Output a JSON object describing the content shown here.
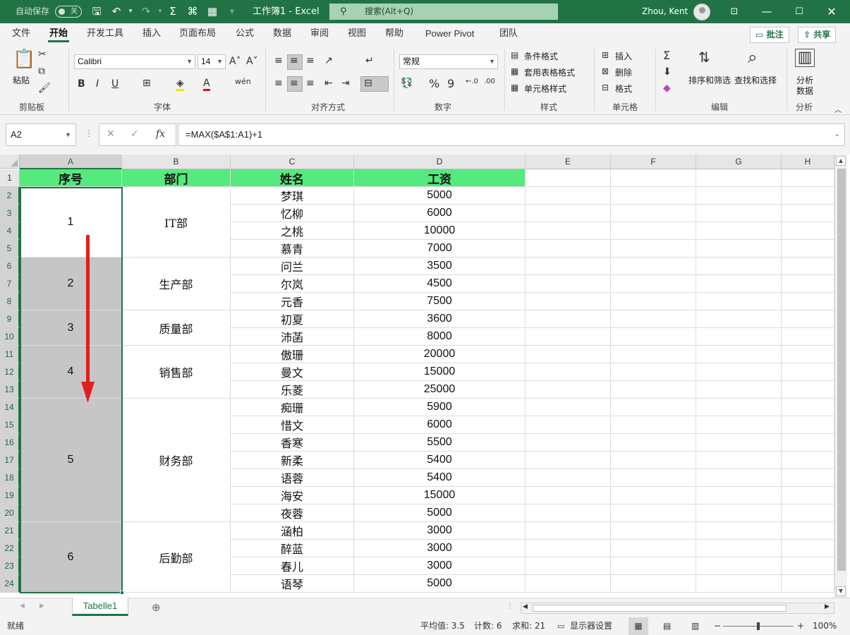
{
  "titlebar": {
    "autosave_label": "自动保存",
    "autosave_state": "关",
    "doc_title": "工作簿1 - Excel",
    "search_placeholder": "搜索(Alt+Q)",
    "user_name": "Zhou, Kent"
  },
  "ribbon_tabs": [
    "文件",
    "开始",
    "开发工具",
    "插入",
    "页面布局",
    "公式",
    "数据",
    "审阅",
    "视图",
    "帮助",
    "Power Pivot",
    "团队"
  ],
  "active_tab": "开始",
  "comment_button": "批注",
  "share_button": "共享",
  "ribbon": {
    "clipboard": {
      "paste": "粘贴",
      "label": "剪贴板"
    },
    "font": {
      "name": "Calibri",
      "size": "14",
      "label": "字体"
    },
    "alignment": {
      "label": "对齐方式"
    },
    "number": {
      "format": "常规",
      "label": "数字"
    },
    "styles": {
      "conditional": "条件格式",
      "table": "套用表格格式",
      "cell": "单元格样式",
      "label": "样式"
    },
    "cells": {
      "insert": "插入",
      "delete": "删除",
      "format": "格式",
      "label": "单元格"
    },
    "editing": {
      "sort": "排序和筛选",
      "find": "查找和选择",
      "label": "编辑"
    },
    "analysis": {
      "analyze": "分析数据",
      "analyze_line1": "分析",
      "analyze_line2": "数据",
      "label": "分析"
    }
  },
  "formula_bar": {
    "name_box": "A2",
    "formula": "=MAX($A$1:A1)+1"
  },
  "columns": [
    "A",
    "B",
    "C",
    "D",
    "E",
    "F",
    "G",
    "H"
  ],
  "rows": [
    "1",
    "2",
    "3",
    "4",
    "5",
    "6",
    "7",
    "8",
    "9",
    "10",
    "11",
    "12",
    "13",
    "14",
    "15",
    "16",
    "17",
    "18",
    "19",
    "20",
    "21",
    "22",
    "23",
    "24"
  ],
  "headers": {
    "seq": "序号",
    "dept": "部门",
    "name": "姓名",
    "salary": "工资"
  },
  "groups": [
    {
      "seq": "1",
      "dept": "IT部"
    },
    {
      "seq": "2",
      "dept": "生产部"
    },
    {
      "seq": "3",
      "dept": "质量部"
    },
    {
      "seq": "4",
      "dept": "销售部"
    },
    {
      "seq": "5",
      "dept": "财务部"
    },
    {
      "seq": "6",
      "dept": "后勤部"
    }
  ],
  "records": [
    {
      "name": "梦琪",
      "salary": "5000"
    },
    {
      "name": "忆柳",
      "salary": "6000"
    },
    {
      "name": "之桃",
      "salary": "10000"
    },
    {
      "name": "慕青",
      "salary": "7000"
    },
    {
      "name": "问兰",
      "salary": "3500"
    },
    {
      "name": "尔岚",
      "salary": "4500"
    },
    {
      "name": "元香",
      "salary": "7500"
    },
    {
      "name": "初夏",
      "salary": "3600"
    },
    {
      "name": "沛菡",
      "salary": "8000"
    },
    {
      "name": "傲珊",
      "salary": "20000"
    },
    {
      "name": "曼文",
      "salary": "15000"
    },
    {
      "name": "乐菱",
      "salary": "25000"
    },
    {
      "name": "痴珊",
      "salary": "5900"
    },
    {
      "name": "惜文",
      "salary": "6000"
    },
    {
      "name": "香寒",
      "salary": "5500"
    },
    {
      "name": "新柔",
      "salary": "5400"
    },
    {
      "name": "语蓉",
      "salary": "5400"
    },
    {
      "name": "海安",
      "salary": "15000"
    },
    {
      "name": "夜蓉",
      "salary": "5000"
    },
    {
      "name": "涵柏",
      "salary": "3000"
    },
    {
      "name": "醉蓝",
      "salary": "3000"
    },
    {
      "name": "春儿",
      "salary": "3000"
    },
    {
      "name": "语琴",
      "salary": "5000"
    }
  ],
  "sheet_tab": "Tabelle1",
  "status": {
    "ready": "就绪",
    "average": "平均值: 3.5",
    "count": "计数: 6",
    "sum": "求和: 21",
    "display_settings": "显示器设置",
    "zoom": "100%"
  },
  "colors": {
    "brand": "#217346",
    "header_fill": "#55ea7e",
    "selection_fill": "#c6c6c6",
    "arrow": "#e02020"
  }
}
